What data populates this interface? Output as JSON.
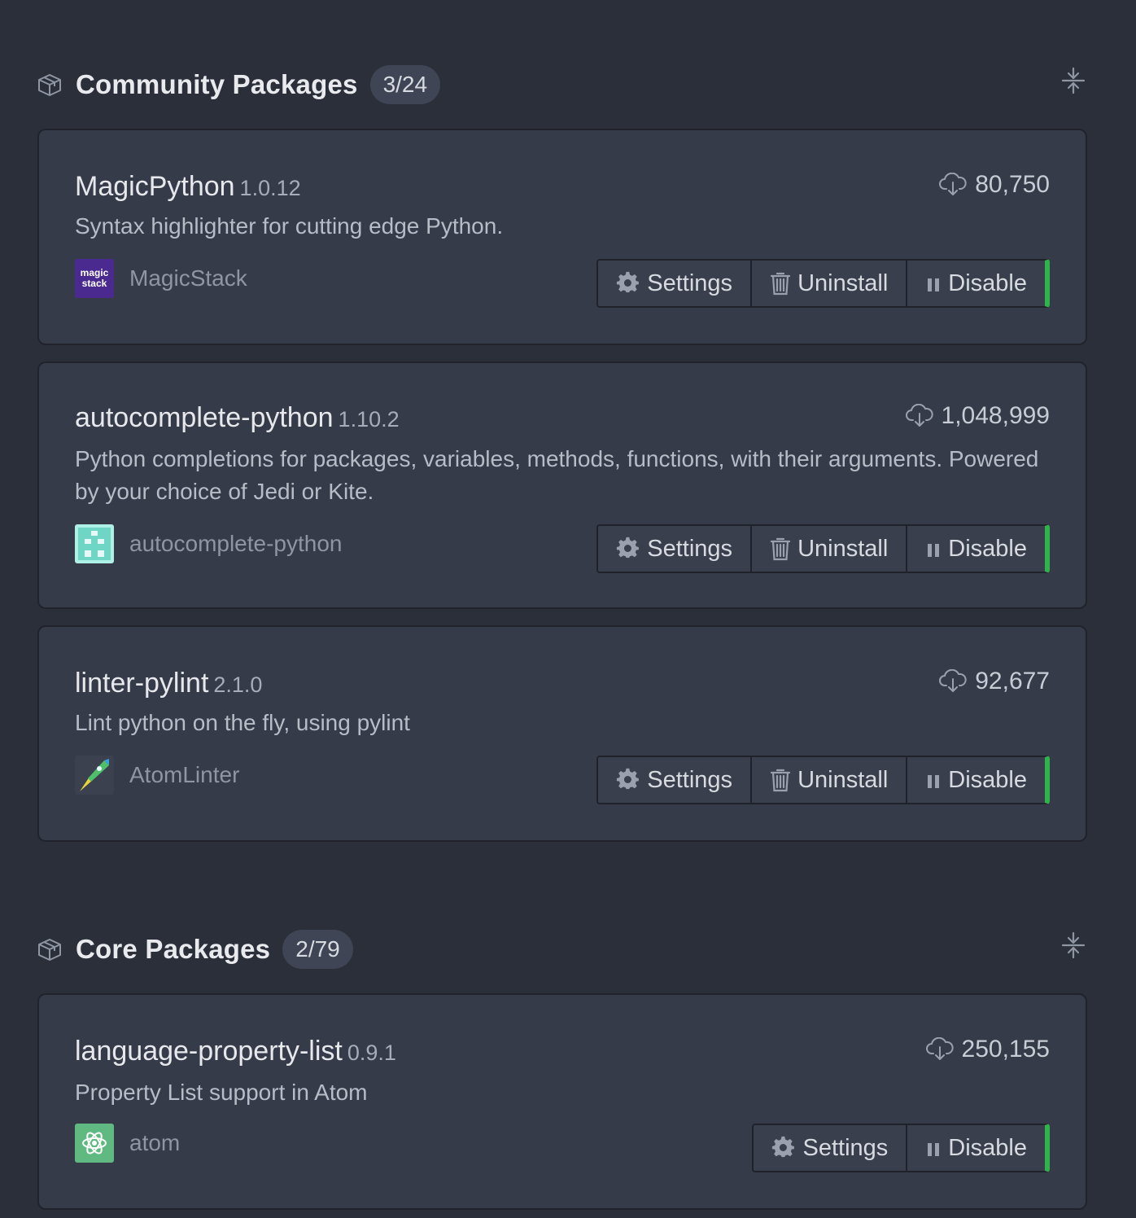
{
  "community": {
    "title": "Community Packages",
    "count": "3/24",
    "packages": [
      {
        "name": "MagicPython",
        "version": "1.0.12",
        "downloads": "80,750",
        "description": "Syntax highlighter for cutting edge Python.",
        "author": "MagicStack",
        "avatar_text_1": "magic",
        "avatar_text_2": "stack",
        "buttons": {
          "settings": "Settings",
          "uninstall": "Uninstall",
          "disable": "Disable"
        }
      },
      {
        "name": "autocomplete-python",
        "version": "1.10.2",
        "downloads": "1,048,999",
        "description": "Python completions for packages, variables, methods, functions, with their arguments. Powered by your choice of Jedi or Kite.",
        "author": "autocomplete-python",
        "buttons": {
          "settings": "Settings",
          "uninstall": "Uninstall",
          "disable": "Disable"
        }
      },
      {
        "name": "linter-pylint",
        "version": "2.1.0",
        "downloads": "92,677",
        "description": "Lint python on the fly, using pylint",
        "author": "AtomLinter",
        "buttons": {
          "settings": "Settings",
          "uninstall": "Uninstall",
          "disable": "Disable"
        }
      }
    ]
  },
  "core": {
    "title": "Core Packages",
    "count": "2/79",
    "packages": [
      {
        "name": "language-property-list",
        "version": "0.9.1",
        "downloads": "250,155",
        "description": "Property List support in Atom",
        "author": "atom",
        "buttons": {
          "settings": "Settings",
          "disable": "Disable"
        }
      }
    ]
  },
  "colors": {
    "background": "#2b2f3a",
    "card": "#363b4a",
    "enabled_indicator": "#2fb34a"
  }
}
